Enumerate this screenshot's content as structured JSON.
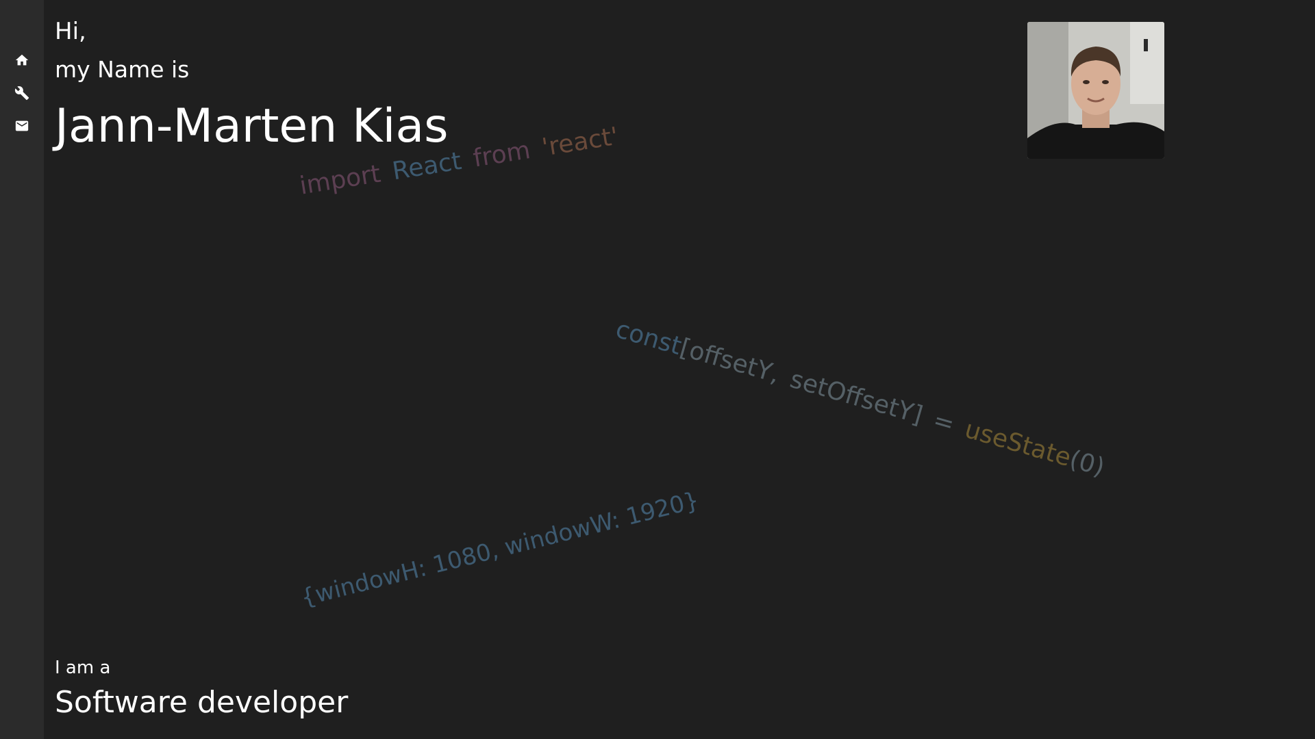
{
  "sidebar": {
    "items": [
      {
        "icon": "home-icon"
      },
      {
        "icon": "wrench-icon"
      },
      {
        "icon": "mail-icon"
      }
    ]
  },
  "hero": {
    "greeting": "Hi,",
    "intro": "my Name is",
    "name": "Jann-Marten Kias",
    "role_prefix": "I am a",
    "role": "Software developer"
  },
  "code_decor": {
    "line1": [
      "import",
      "React",
      "from",
      "'react'"
    ],
    "line2": [
      "const",
      "[offsetY,",
      "setOffsetY]",
      "=",
      "useState",
      "(0)"
    ],
    "line3": "{windowH: 1080, windowW: 1920}"
  },
  "colors": {
    "background": "#1f1f1f",
    "sidebar": "#2b2b2b",
    "text": "#ffffff",
    "code_keyword": "#5c3f52",
    "code_identifier": "#3d5a70",
    "code_function": "#6b5a2e",
    "code_punct": "#556066"
  }
}
